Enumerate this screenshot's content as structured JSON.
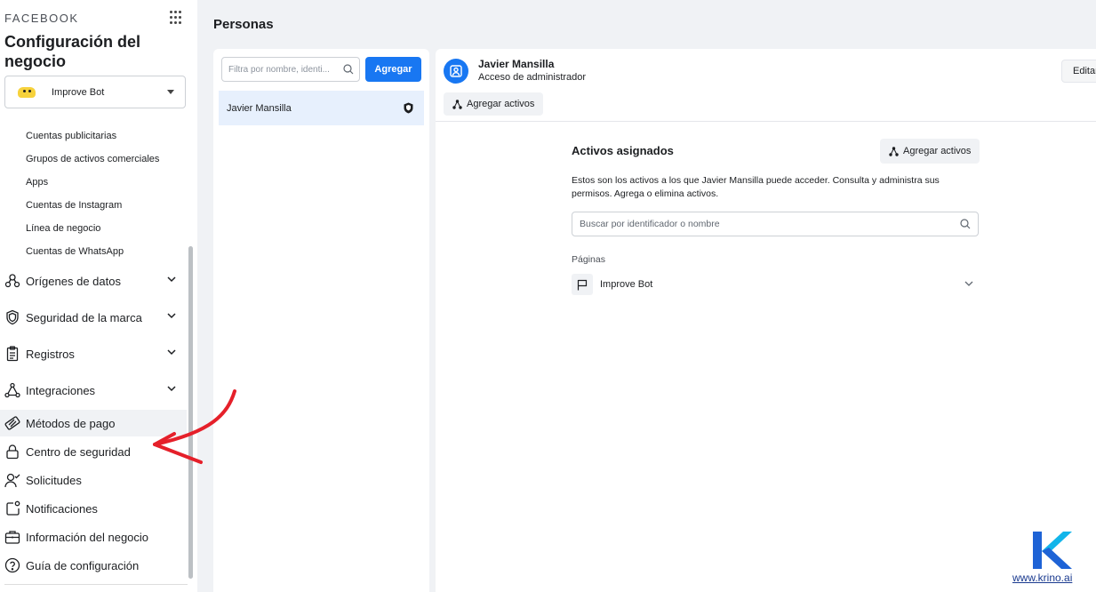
{
  "sidebar": {
    "brand": "FACEBOOK",
    "title": "Configuración del negocio",
    "account": {
      "name": "Improve Bot"
    },
    "sub_items": [
      "Cuentas publicitarias",
      "Grupos de activos comerciales",
      "Apps",
      "Cuentas de Instagram",
      "Línea de negocio",
      "Cuentas de WhatsApp"
    ],
    "nav": [
      {
        "label": "Orígenes de datos",
        "icon": "data-sources-icon",
        "expandable": true
      },
      {
        "label": "Seguridad de la marca",
        "icon": "shield-icon",
        "expandable": true
      },
      {
        "label": "Registros",
        "icon": "clipboard-icon",
        "expandable": true
      },
      {
        "label": "Integraciones",
        "icon": "integrations-icon",
        "expandable": true
      },
      {
        "label": "Métodos de pago",
        "icon": "payment-icon",
        "expandable": false
      },
      {
        "label": "Centro de seguridad",
        "icon": "lock-icon",
        "expandable": false
      },
      {
        "label": "Solicitudes",
        "icon": "person-check-icon",
        "expandable": false
      },
      {
        "label": "Notificaciones",
        "icon": "notification-icon",
        "expandable": false
      },
      {
        "label": "Información del negocio",
        "icon": "briefcase-icon",
        "expandable": false
      },
      {
        "label": "Guía de configuración",
        "icon": "help-icon",
        "expandable": false
      }
    ]
  },
  "header": {
    "title": "Personas"
  },
  "people": {
    "filter_placeholder": "Filtra por nombre, identi...",
    "add_label": "Agregar",
    "selected_person": "Javier Mansilla"
  },
  "detail": {
    "name": "Javier Mansilla",
    "role": "Acceso de administrador",
    "edit_label": "Editar",
    "add_assets_label": "Agregar activos",
    "assets_title": "Activos asignados",
    "assets_add_label": "Agregar activos",
    "assets_description": "Estos son los activos a los que Javier Mansilla puede acceder. Consulta y administra sus permisos. Agrega o elimina activos.",
    "assets_search_placeholder": "Buscar por identificador o nombre",
    "pages_label": "Páginas",
    "page_item": "Improve Bot"
  },
  "watermark": {
    "url": "www.krino.ai"
  },
  "colors": {
    "primary": "#1877f2",
    "annotation": "#e5202a",
    "logo_blue": "#1e63d6",
    "logo_cyan": "#12b5ea"
  }
}
